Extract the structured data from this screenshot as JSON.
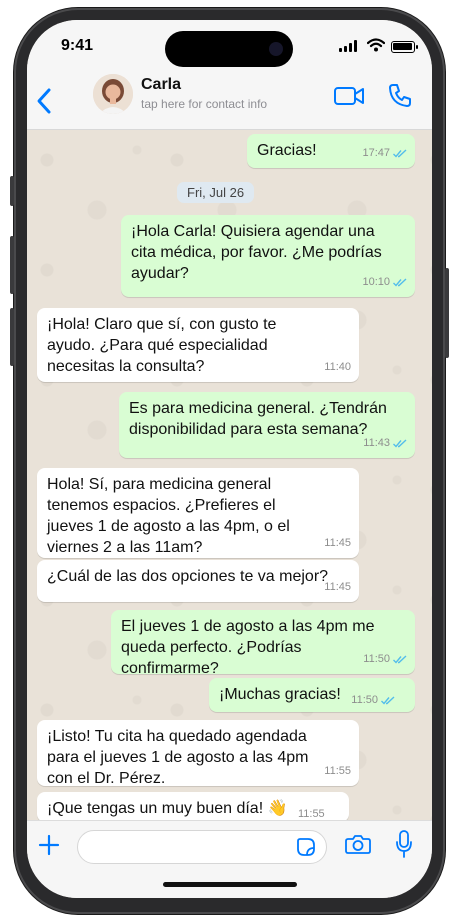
{
  "status_bar": {
    "time": "9:41"
  },
  "header": {
    "contact_name": "Carla",
    "contact_subtitle": "tap here for contact info"
  },
  "date_chip": "Fri, Jul 26",
  "messages": [
    {
      "dir": "out",
      "text": "Gracias!",
      "time": "17:47",
      "read": true
    },
    {
      "dir": "out",
      "text": "¡Hola Carla! Quisiera agendar una\ncita médica, por favor. ¿Me podrías\nayudar?",
      "time": "10:10",
      "read": true
    },
    {
      "dir": "in",
      "text": "¡Hola! Claro que sí, con gusto te\nayudo. ¿Para qué especialidad\nnecesitas la consulta?",
      "time": "11:40"
    },
    {
      "dir": "out",
      "text": "Es para medicina general. ¿Tendrán\ndisponibilidad para esta semana?",
      "time": "11:43",
      "read": true
    },
    {
      "dir": "in",
      "text": "Hola! Sí, para medicina general\ntenemos espacios. ¿Prefieres el\njueves 1 de agosto a las 4pm, o el\nviernes 2 a las 11am?",
      "time": "11:45"
    },
    {
      "dir": "in",
      "text": "¿Cuál de las dos opciones te va mejor?",
      "time": "11:45"
    },
    {
      "dir": "out",
      "text": "El jueves 1 de agosto a las 4pm me\nqueda perfecto. ¿Podrías\nconfirmarme?",
      "time": "11:50",
      "read": true
    },
    {
      "dir": "out",
      "text": "¡Muchas gracias!",
      "time": "11:50",
      "read": true
    },
    {
      "dir": "in",
      "text": "¡Listo! Tu cita ha quedado agendada\npara el jueves 1 de agosto a las 4pm\ncon el Dr. Pérez.",
      "time": "11:55"
    },
    {
      "dir": "in",
      "text": "¡Que tengas un muy buen día! 👋",
      "time": "11:55"
    }
  ],
  "colors": {
    "accent": "#007aff",
    "outgoing_bubble": "#d9fdd3",
    "incoming_bubble": "#ffffff",
    "read_tick": "#53bdeb"
  },
  "icons": {
    "back": "chevron-left-icon",
    "video": "video-camera-icon",
    "call": "phone-icon",
    "add": "plus-icon",
    "sticker": "sticker-icon",
    "camera": "camera-icon",
    "mic": "microphone-icon"
  }
}
